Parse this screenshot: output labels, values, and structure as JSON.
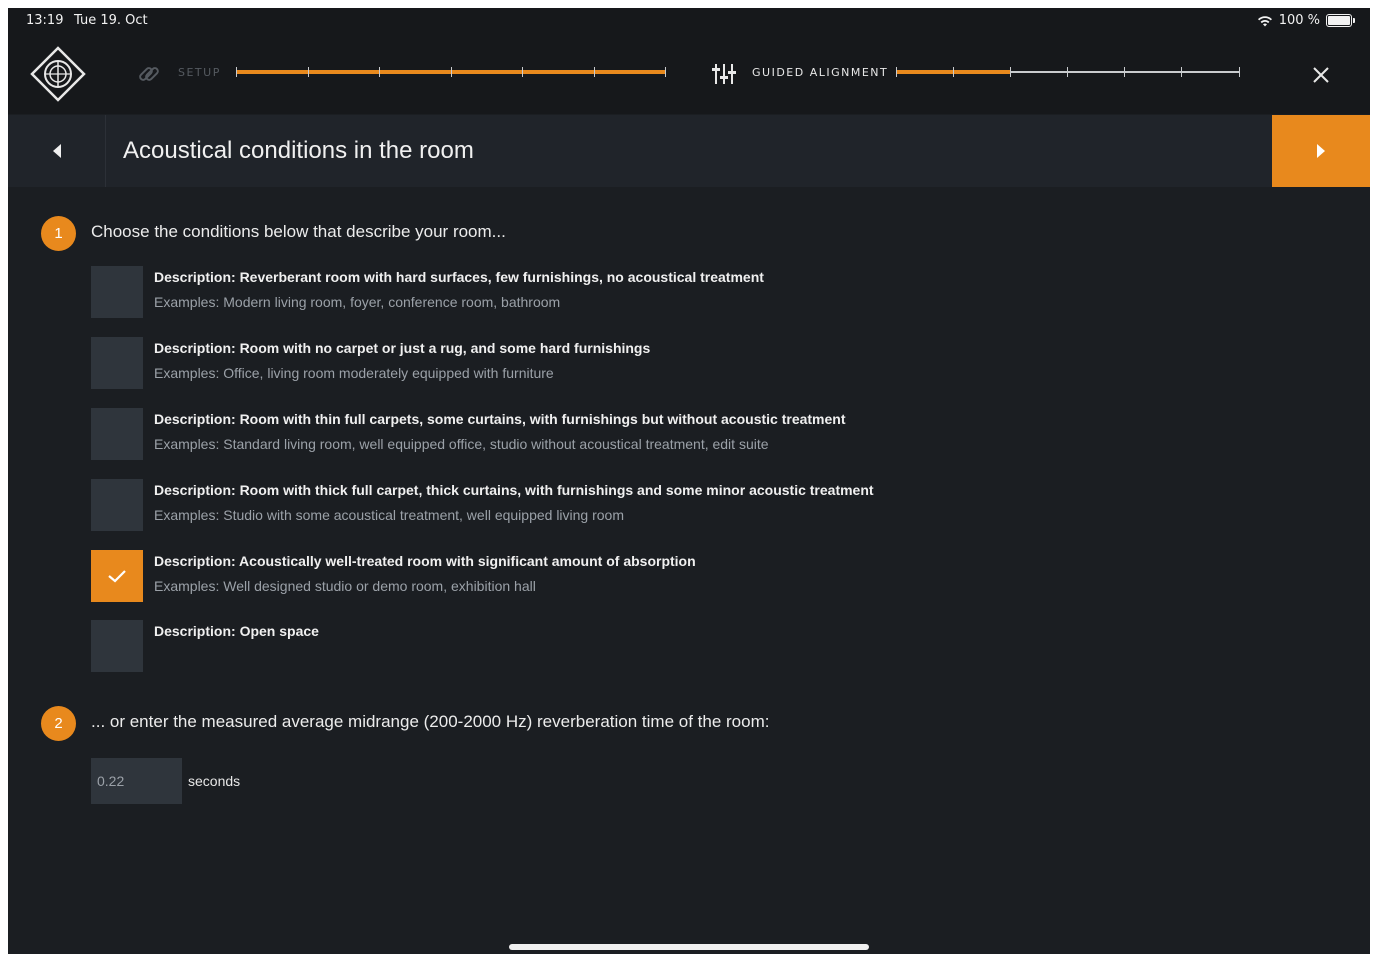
{
  "status_bar": {
    "time": "13:19",
    "date": "Tue 19. Oct",
    "battery": "100 %"
  },
  "nav": {
    "setup_label": "Setup",
    "guided_label": "Guided Alignment",
    "setup_progress": 1.0,
    "guided_progress": 0.33
  },
  "header": {
    "title": "Acoustical conditions in the room"
  },
  "step1": {
    "number": "1",
    "text": "Choose the conditions below that describe your room...",
    "options": [
      {
        "description": "Description: Reverberant room with hard surfaces, few furnishings, no acoustical treatment",
        "examples": "Examples: Modern living room, foyer, conference room, bathroom",
        "checked": false
      },
      {
        "description": "Description: Room with no carpet or just a rug, and some hard furnishings",
        "examples": "Examples: Office, living room moderately equipped with furniture",
        "checked": false
      },
      {
        "description": "Description: Room with thin full carpets, some curtains, with furnishings but without acoustic treatment",
        "examples": "Examples: Standard living room, well equipped office, studio without acoustical treatment, edit suite",
        "checked": false
      },
      {
        "description": "Description: Room with thick full carpet, thick curtains, with furnishings and some minor acoustic treatment",
        "examples": "Examples: Studio with some acoustical treatment, well equipped living room",
        "checked": false
      },
      {
        "description": "Description: Acoustically well-treated room with significant amount of absorption",
        "examples": "Examples: Well designed studio or demo room, exhibition hall",
        "checked": true
      },
      {
        "description": "Description: Open space",
        "examples": "",
        "checked": false
      }
    ]
  },
  "step2": {
    "number": "2",
    "text": "... or enter the measured average midrange (200-2000 Hz) reverberation time of the room:",
    "value": "0.22",
    "unit": "seconds"
  },
  "colors": {
    "accent": "#e8891d",
    "background": "#1b1e22",
    "bar": "#16181b",
    "checkbox": "#2f353c"
  }
}
